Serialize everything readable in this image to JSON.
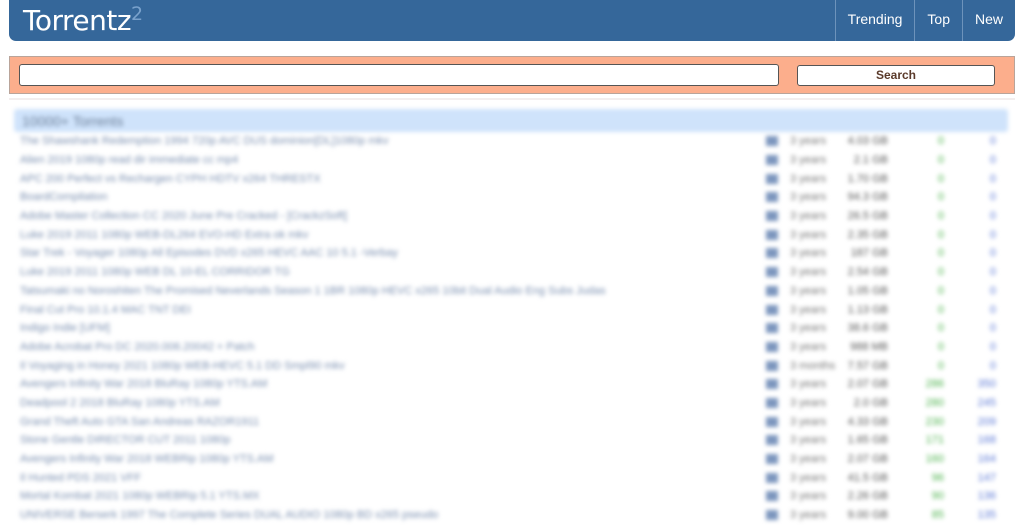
{
  "header": {
    "logo": "Torrentz",
    "logo_sup": "2",
    "nav": [
      "Trending",
      "Top",
      "New"
    ]
  },
  "search": {
    "value": "",
    "placeholder": "",
    "button": "Search"
  },
  "results": {
    "heading": "10000+ Torrents",
    "rows": [
      {
        "title": "The Shawshank Redemption 1994 720p AVC DUS dominion[DL]1080p mkv",
        "age": "3 years",
        "size": "4.03 GB",
        "seeds": "0",
        "peers": "0"
      },
      {
        "title": "Alien 2019 1080p read dir immediate cc mp4",
        "age": "3 years",
        "size": "2.1 GB",
        "seeds": "0",
        "peers": "0"
      },
      {
        "title": "APC 200 Perfect vs Rechargen CYPH HDTV x264 THRESTX",
        "age": "3 years",
        "size": "1.70 GB",
        "seeds": "0",
        "peers": "0"
      },
      {
        "title": "BoardCompilation",
        "age": "3 years",
        "size": "94.3 GB",
        "seeds": "0",
        "peers": "0"
      },
      {
        "title": "Adobe Master Collection CC 2020 June Pre Cracked - [CrackzSoft]",
        "age": "3 years",
        "size": "26.5 GB",
        "seeds": "0",
        "peers": "0"
      },
      {
        "title": "Luke 2019 2011 1080p WEB-DL264 EVO-HD Extra ok mkv",
        "age": "3 years",
        "size": "2.35 GB",
        "seeds": "0",
        "peers": "0"
      },
      {
        "title": "Star Trek - Voyager 1080p All Episodes DVD x265 HEVC AAC 10 5.1 -Verbay",
        "age": "3 years",
        "size": "187 GB",
        "seeds": "0",
        "peers": "0"
      },
      {
        "title": "Luke 2019 2011 1080p WEB DL 10-EL CORRIDOR TG",
        "age": "3 years",
        "size": "2.54 GB",
        "seeds": "0",
        "peers": "0"
      },
      {
        "title": "Tatsumaki no Noroshiten The Promised Neverlands Season 1 1BR 1080p HEVC x265 10bit Dual Audio Eng Subs Judas",
        "age": "3 years",
        "size": "1.05 GB",
        "seeds": "0",
        "peers": "0"
      },
      {
        "title": "Final Cut Pro 10.1.4 MAC TNT DEI",
        "age": "3 years",
        "size": "1.13 GB",
        "seeds": "0",
        "peers": "0"
      },
      {
        "title": "Indigo Indie [UFM]",
        "age": "3 years",
        "size": "38.6 GB",
        "seeds": "0",
        "peers": "0"
      },
      {
        "title": "Adobe Acrobat Pro DC 2020.006.20042 + Patch",
        "age": "3 years",
        "size": "988 MB",
        "seeds": "0",
        "peers": "0"
      },
      {
        "title": "Il Voyaging in Honey 2021 1080p WEB-HEVC 5.1 DD Smpl90 mkv",
        "age": "3 months",
        "size": "7.57 GB",
        "seeds": "0",
        "peers": "0"
      },
      {
        "title": "Avengers Infinity War 2018 BluRay 1080p YTS.AM",
        "age": "3 years",
        "size": "2.07 GB",
        "seeds": "286",
        "peers": "350"
      },
      {
        "title": "Deadpool 2 2018 BluRay 1080p YTS.AM",
        "age": "3 years",
        "size": "2.0 GB",
        "seeds": "280",
        "peers": "245"
      },
      {
        "title": "Grand Theft Auto GTA San Andreas RAZOR1911",
        "age": "3 years",
        "size": "4.33 GB",
        "seeds": "230",
        "peers": "209"
      },
      {
        "title": "Stone Gentle DIRECTOR CUT 2011 1080p",
        "age": "3 years",
        "size": "1.65 GB",
        "seeds": "171",
        "peers": "168"
      },
      {
        "title": "Avengers Infinity War 2018 WEBRip 1080p YTS.AM",
        "age": "3 years",
        "size": "2.07 GB",
        "seeds": "160",
        "peers": "164"
      },
      {
        "title": "Il Hunted PDS 2021 VFF",
        "age": "3 years",
        "size": "41.5 GB",
        "seeds": "96",
        "peers": "147"
      },
      {
        "title": "Mortal Kombat 2021 1080p WEBRip 5.1 YTS.MX",
        "age": "3 years",
        "size": "2.26 GB",
        "seeds": "90",
        "peers": "136"
      },
      {
        "title": "UNIVERSE Berserk 1997 The Complete Series DUAL AUDIO 1080p BD x265 pseudo",
        "age": "3 years",
        "size": "9.00 GB",
        "seeds": "85",
        "peers": "135"
      }
    ]
  },
  "colors": {
    "header": "#35679a",
    "search_bar": "#fcae8c",
    "results_heading": "#cfe3fb",
    "seeds": "#4bb24b",
    "peers": "#5b78d6"
  }
}
